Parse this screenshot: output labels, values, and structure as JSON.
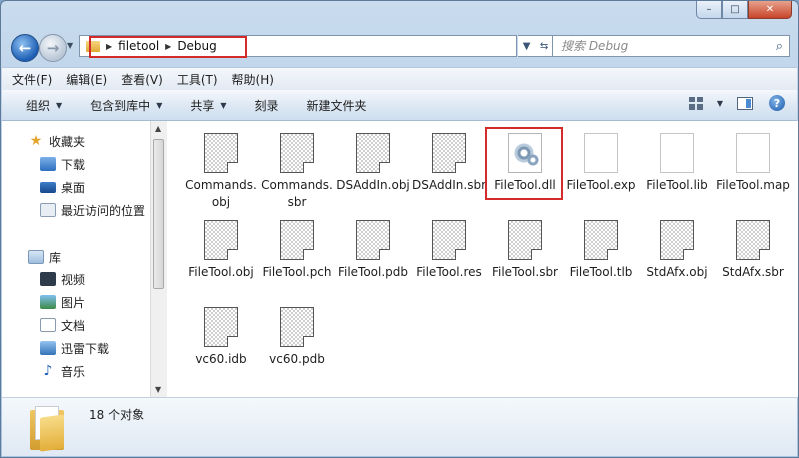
{
  "window": {
    "caption": {
      "minimize": "–",
      "maximize": "□",
      "close": "✕"
    }
  },
  "navigation": {
    "back_icon": "back-arrow-icon",
    "forward_icon": "forward-arrow-icon",
    "breadcrumb": [
      "filetool",
      "Debug"
    ],
    "refresh_icon": "refresh-icon",
    "search_placeholder": "搜索 Debug"
  },
  "menu": [
    "文件(F)",
    "编辑(E)",
    "查看(V)",
    "工具(T)",
    "帮助(H)"
  ],
  "commands": {
    "organize": "组织",
    "include_in_library": "包含到库中",
    "share": "共享",
    "burn": "刻录",
    "new_folder": "新建文件夹"
  },
  "sidebar": {
    "favorites": {
      "label": "收藏夹",
      "items": [
        "下载",
        "桌面",
        "最近访问的位置"
      ]
    },
    "libraries": {
      "label": "库",
      "items": [
        "视频",
        "图片",
        "文档",
        "迅雷下载",
        "音乐"
      ]
    }
  },
  "files": [
    {
      "name": "Commands.obj",
      "icon": "generic-file-icon"
    },
    {
      "name": "Commands.sbr",
      "icon": "generic-file-icon"
    },
    {
      "name": "DSAddIn.obj",
      "icon": "generic-file-icon"
    },
    {
      "name": "DSAddIn.sbr",
      "icon": "generic-file-icon"
    },
    {
      "name": "FileTool.dll",
      "icon": "dll-gear-icon",
      "highlighted": true
    },
    {
      "name": "FileTool.exp",
      "icon": "blank-file-icon"
    },
    {
      "name": "FileTool.lib",
      "icon": "blank-file-icon"
    },
    {
      "name": "FileTool.map",
      "icon": "blank-file-icon"
    },
    {
      "name": "FileTool.obj",
      "icon": "generic-file-icon"
    },
    {
      "name": "FileTool.pch",
      "icon": "generic-file-icon"
    },
    {
      "name": "FileTool.pdb",
      "icon": "generic-file-icon"
    },
    {
      "name": "FileTool.res",
      "icon": "generic-file-icon"
    },
    {
      "name": "FileTool.sbr",
      "icon": "generic-file-icon"
    },
    {
      "name": "FileTool.tlb",
      "icon": "generic-file-icon"
    },
    {
      "name": "StdAfx.obj",
      "icon": "generic-file-icon"
    },
    {
      "name": "StdAfx.sbr",
      "icon": "generic-file-icon"
    },
    {
      "name": "vc60.idb",
      "icon": "generic-file-icon"
    },
    {
      "name": "vc60.pdb",
      "icon": "generic-file-icon"
    }
  ],
  "status": {
    "item_count": "18 个对象"
  },
  "colors": {
    "highlight_red": "#d42a2a",
    "accent_blue": "#1d5fb5"
  }
}
